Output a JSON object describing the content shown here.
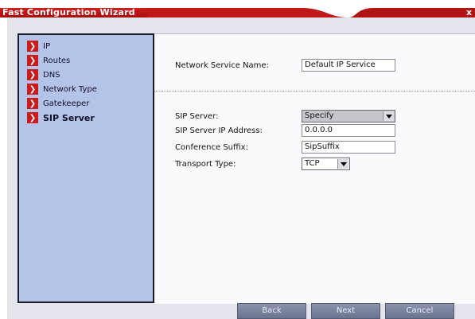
{
  "window": {
    "title": "Fast Configuration Wizard",
    "close_label": "x"
  },
  "sidebar": {
    "items": [
      {
        "label": "IP",
        "active": false
      },
      {
        "label": "Routes",
        "active": false
      },
      {
        "label": "DNS",
        "active": false
      },
      {
        "label": "Network Type",
        "active": false
      },
      {
        "label": "Gatekeeper",
        "active": false
      },
      {
        "label": "SIP Server",
        "active": true
      }
    ],
    "arrow_glyph": "❯"
  },
  "form": {
    "network_service_name_label": "Network Service Name:",
    "network_service_name_value": "Default IP Service",
    "sip_server_label": "SIP Server:",
    "sip_server_value": "Specify",
    "sip_server_ip_label": "SIP Server IP Address:",
    "sip_server_ip_value": "0.0.0.0",
    "conference_suffix_label": "Conference Suffix:",
    "conference_suffix_value": "SipSuffix",
    "transport_type_label": "Transport Type:",
    "transport_type_value": "TCP"
  },
  "footer": {
    "back_label": "Back",
    "next_label": "Next",
    "cancel_label": "Cancel"
  },
  "colors": {
    "title_red": "#c01818",
    "nav_arrow_red": "#cc1b1b",
    "sidebar_blue": "#b4c3e8",
    "button_slate": "#7a839d"
  }
}
